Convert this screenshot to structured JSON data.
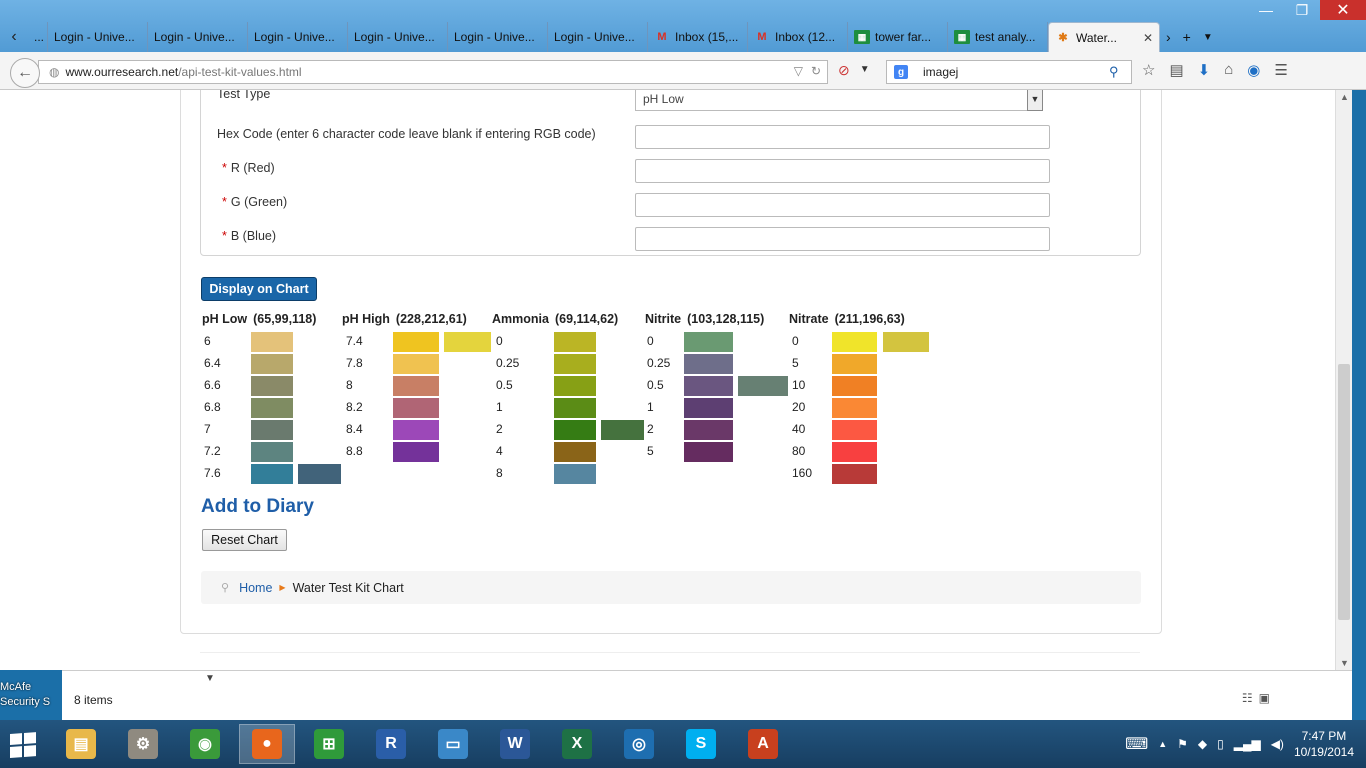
{
  "browser": {
    "tabs": [
      {
        "label": "...",
        "icon": "none"
      },
      {
        "label": "Login - Unive...",
        "icon": "none"
      },
      {
        "label": "Login - Unive...",
        "icon": "none"
      },
      {
        "label": "Login - Unive...",
        "icon": "none"
      },
      {
        "label": "Login - Unive...",
        "icon": "none"
      },
      {
        "label": "Login - Unive...",
        "icon": "none"
      },
      {
        "label": "Login - Unive...",
        "icon": "none"
      },
      {
        "label": "Inbox (15,...",
        "icon": "gmail-icon"
      },
      {
        "label": "Inbox (12...",
        "icon": "gmail-icon"
      },
      {
        "label": "tower far...",
        "icon": "sheets-icon"
      },
      {
        "label": "test analy...",
        "icon": "sheets-icon"
      }
    ],
    "active_tab": {
      "label": "Water...",
      "icon": "joomla-icon"
    },
    "url": {
      "host": "www.ourresearch.net",
      "path": "/api-test-kit-values.html"
    },
    "search": {
      "value": "imagej"
    }
  },
  "form": {
    "test_type_label": "Test Type",
    "test_type_value": "pH Low",
    "hex_label": "Hex Code (enter 6 character code leave blank if entering RGB code)",
    "required_mark": "*",
    "r_label": "R (Red)",
    "g_label": "G (Green)",
    "b_label": "B (Blue)"
  },
  "display_button": "Display on Chart",
  "chart_groups": [
    {
      "name": "pH Low",
      "rgb": "(65,99,118)",
      "levels": [
        "6",
        "6.4",
        "6.6",
        "6.8",
        "7",
        "7.2",
        "7.6"
      ],
      "colors": [
        "#e4c27a",
        "#b8a86b",
        "#8a8a68",
        "#7f8c62",
        "#6a7a6e",
        "#5d8480",
        "#327e99"
      ],
      "match_index": 6,
      "match_color": "#41637a"
    },
    {
      "name": "pH High",
      "rgb": "(228,212,61)",
      "levels": [
        "7.4",
        "7.8",
        "8",
        "8.2",
        "8.4",
        "8.8"
      ],
      "colors": [
        "#efc420",
        "#f0c250",
        "#c87f65",
        "#b06575",
        "#9c48b8",
        "#74329a"
      ],
      "match_index": 0,
      "match_color": "#e4d43d"
    },
    {
      "name": "Ammonia",
      "rgb": "(69,114,62)",
      "levels": [
        "0",
        "0.25",
        "0.5",
        "1",
        "2",
        "4",
        "8"
      ],
      "colors": [
        "#bbb525",
        "#a8ae1e",
        "#87a015",
        "#5b8c16",
        "#357c14",
        "#8a6418",
        "#5686a0"
      ],
      "match_index": 4,
      "match_color": "#45723e"
    },
    {
      "name": "Nitrite",
      "rgb": "(103,128,115)",
      "levels": [
        "0",
        "0.25",
        "0.5",
        "1",
        "2",
        "5"
      ],
      "colors": [
        "#6a9a72",
        "#6e6e8a",
        "#6a5680",
        "#5d3f72",
        "#6a3868",
        "#652c60"
      ],
      "match_index": 2,
      "match_color": "#678073"
    },
    {
      "name": "Nitrate",
      "rgb": "(211,196,63)",
      "levels": [
        "0",
        "5",
        "10",
        "20",
        "40",
        "80",
        "160"
      ],
      "colors": [
        "#f0e42a",
        "#f0a82a",
        "#f08024",
        "#fa8834",
        "#fc5842",
        "#f84040",
        "#b83a38"
      ],
      "match_index": 0,
      "match_color": "#d3c43f"
    }
  ],
  "add_to_diary": "Add to Diary",
  "reset_button": "Reset Chart",
  "breadcrumb": {
    "home": "Home",
    "current": "Water Test Kit Chart"
  },
  "explorer": {
    "item_count": "8 items"
  },
  "desktop": {
    "mcafee_line1": "McAfe",
    "mcafee_line2": "Security S"
  },
  "taskbar": {
    "apps": [
      {
        "name": "file-explorer",
        "glyph": "▤",
        "color": "#e8b84a"
      },
      {
        "name": "control-panel",
        "glyph": "⚙",
        "color": "#8f8a80"
      },
      {
        "name": "chrome",
        "glyph": "◉",
        "color": "#3a9a3a"
      },
      {
        "name": "firefox",
        "glyph": "●",
        "color": "#e8661c"
      },
      {
        "name": "store",
        "glyph": "⊞",
        "color": "#2f9a3a"
      },
      {
        "name": "r",
        "glyph": "R",
        "color": "#2a5ea8"
      },
      {
        "name": "explorer-2",
        "glyph": "▭",
        "color": "#3a88c8"
      },
      {
        "name": "word",
        "glyph": "W",
        "color": "#2b5797"
      },
      {
        "name": "excel",
        "glyph": "X",
        "color": "#1e7145"
      },
      {
        "name": "media",
        "glyph": "◎",
        "color": "#1e6eb0"
      },
      {
        "name": "skype",
        "glyph": "S",
        "color": "#00aff0"
      },
      {
        "name": "acrobat",
        "glyph": "A",
        "color": "#c8401e"
      }
    ],
    "time": "7:47 PM",
    "date": "10/19/2014"
  }
}
